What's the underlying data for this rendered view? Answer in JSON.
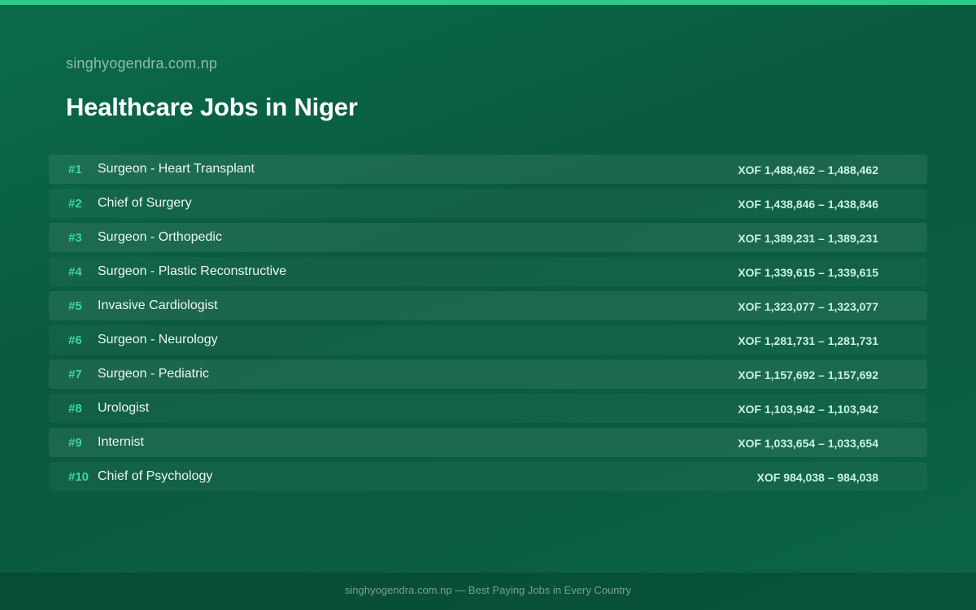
{
  "site_name": "singhyogendra.com.np",
  "page_title": "Healthcare Jobs in Niger",
  "jobs": [
    {
      "rank": "#1",
      "title": "Surgeon - Heart Transplant",
      "salary": "XOF 1,488,462 – 1,488,462"
    },
    {
      "rank": "#2",
      "title": "Chief of Surgery",
      "salary": "XOF 1,438,846 – 1,438,846"
    },
    {
      "rank": "#3",
      "title": "Surgeon - Orthopedic",
      "salary": "XOF 1,389,231 – 1,389,231"
    },
    {
      "rank": "#4",
      "title": "Surgeon - Plastic Reconstructive",
      "salary": "XOF 1,339,615 – 1,339,615"
    },
    {
      "rank": "#5",
      "title": "Invasive Cardiologist",
      "salary": "XOF 1,323,077 – 1,323,077"
    },
    {
      "rank": "#6",
      "title": "Surgeon - Neurology",
      "salary": "XOF 1,281,731 – 1,281,731"
    },
    {
      "rank": "#7",
      "title": "Surgeon - Pediatric",
      "salary": "XOF 1,157,692 – 1,157,692"
    },
    {
      "rank": "#8",
      "title": "Urologist",
      "salary": "XOF 1,103,942 – 1,103,942"
    },
    {
      "rank": "#9",
      "title": "Internist",
      "salary": "XOF 1,033,654 – 1,033,654"
    },
    {
      "rank": "#10",
      "title": "Chief of Psychology",
      "salary": "XOF 984,038 – 984,038"
    }
  ],
  "footer": "singhyogendra.com.np — Best Paying Jobs in Every Country",
  "colors": {
    "accent": "#2fc98a",
    "rank": "#3fd596",
    "salary": "#c9f3de",
    "background": "#0a5c42"
  }
}
